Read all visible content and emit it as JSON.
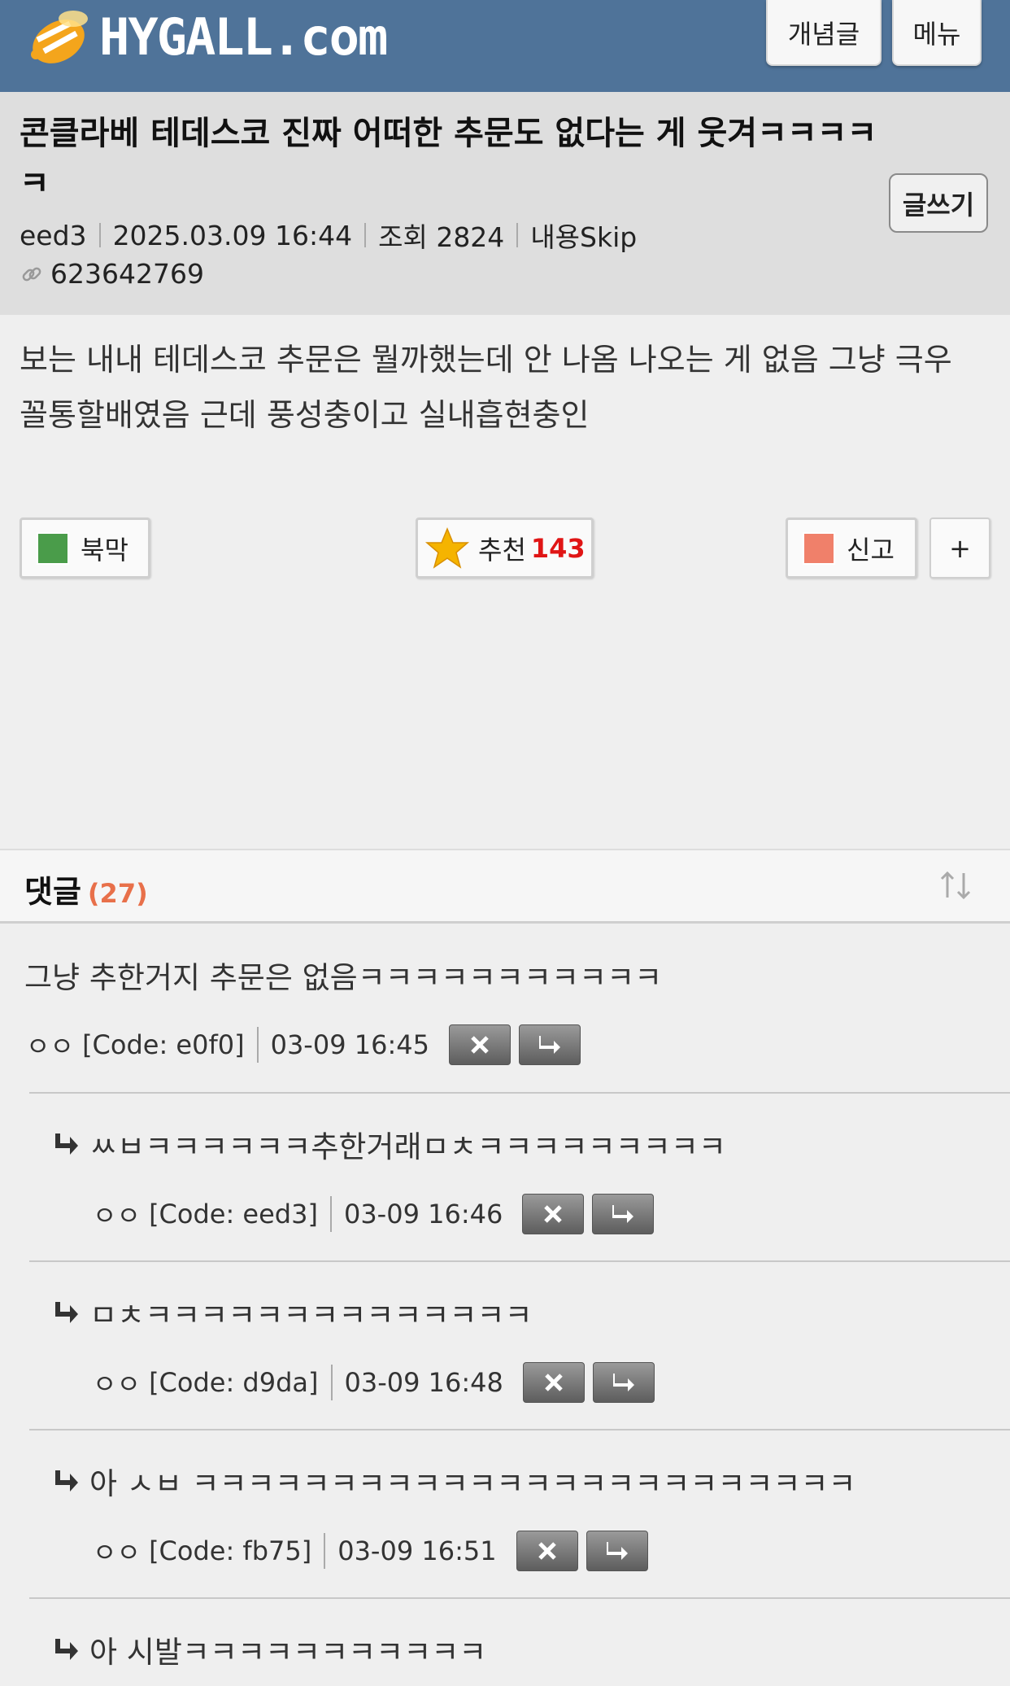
{
  "header": {
    "logo_text": "HYGALL.com",
    "concept_button": "개념글",
    "menu_button": "메뉴",
    "brand_color": "#4f7399"
  },
  "post": {
    "title": "콘클라베 테데스코 진짜 어떠한 추문도 없다는 게 웃겨ㅋㅋㅋㅋㅋ",
    "write_button": "글쓰기",
    "author": "eed3",
    "datetime": "2025.03.09 16:44",
    "views": "조회 2824",
    "skip": "내용Skip",
    "post_id": "623642769",
    "body": "보는 내내 테데스코 추문은 뭘까했는데 안 나옴 나오는 게 없음 그냥 극우 꼴통할배였음 근데 풍성충이고 실내흡현충인"
  },
  "actions": {
    "bookmark_label": "북막",
    "recommend_label": "추천",
    "recommend_count": "143",
    "report_label": "신고",
    "plus_label": "+",
    "bookmark_color": "#4a9c4a",
    "report_color": "#f0806a",
    "star_color": "#f5b400"
  },
  "comments_header": {
    "title": "댓글",
    "count": "(27)",
    "sort_icon": "sort-arrows-icon"
  },
  "comments": [
    {
      "text": "그냥 추한거지 추문은 없음ㅋㅋㅋㅋㅋㅋㅋㅋㅋㅋㅋ",
      "nick": "ㅇㅇ",
      "code": "[Code: e0f0]",
      "time": "03-09 16:45",
      "reply": false
    },
    {
      "text": "ㅆㅂㅋㅋㅋㅋㅋㅋ추한거래ㅁㅊㅋㅋㅋㅋㅋㅋㅋㅋㅋ",
      "nick": "ㅇㅇ",
      "code": "[Code: eed3]",
      "time": "03-09 16:46",
      "reply": true
    },
    {
      "text": "ㅁㅊㅋㅋㅋㅋㅋㅋㅋㅋㅋㅋㅋㅋㅋㅋ",
      "nick": "ㅇㅇ",
      "code": "[Code: d9da]",
      "time": "03-09 16:48",
      "reply": true
    },
    {
      "text": "아 ㅅㅂ ㅋㅋㅋㅋㅋㅋㅋㅋㅋㅋㅋㅋㅋㅋㅋㅋㅋㅋㅋㅋㅋㅋㅋㅋ",
      "nick": "ㅇㅇ",
      "code": "[Code: fb75]",
      "time": "03-09 16:51",
      "reply": true
    },
    {
      "text": "아 시발ㅋㅋㅋㅋㅋㅋㅋㅋㅋㅋㅋ",
      "reply": true
    }
  ]
}
